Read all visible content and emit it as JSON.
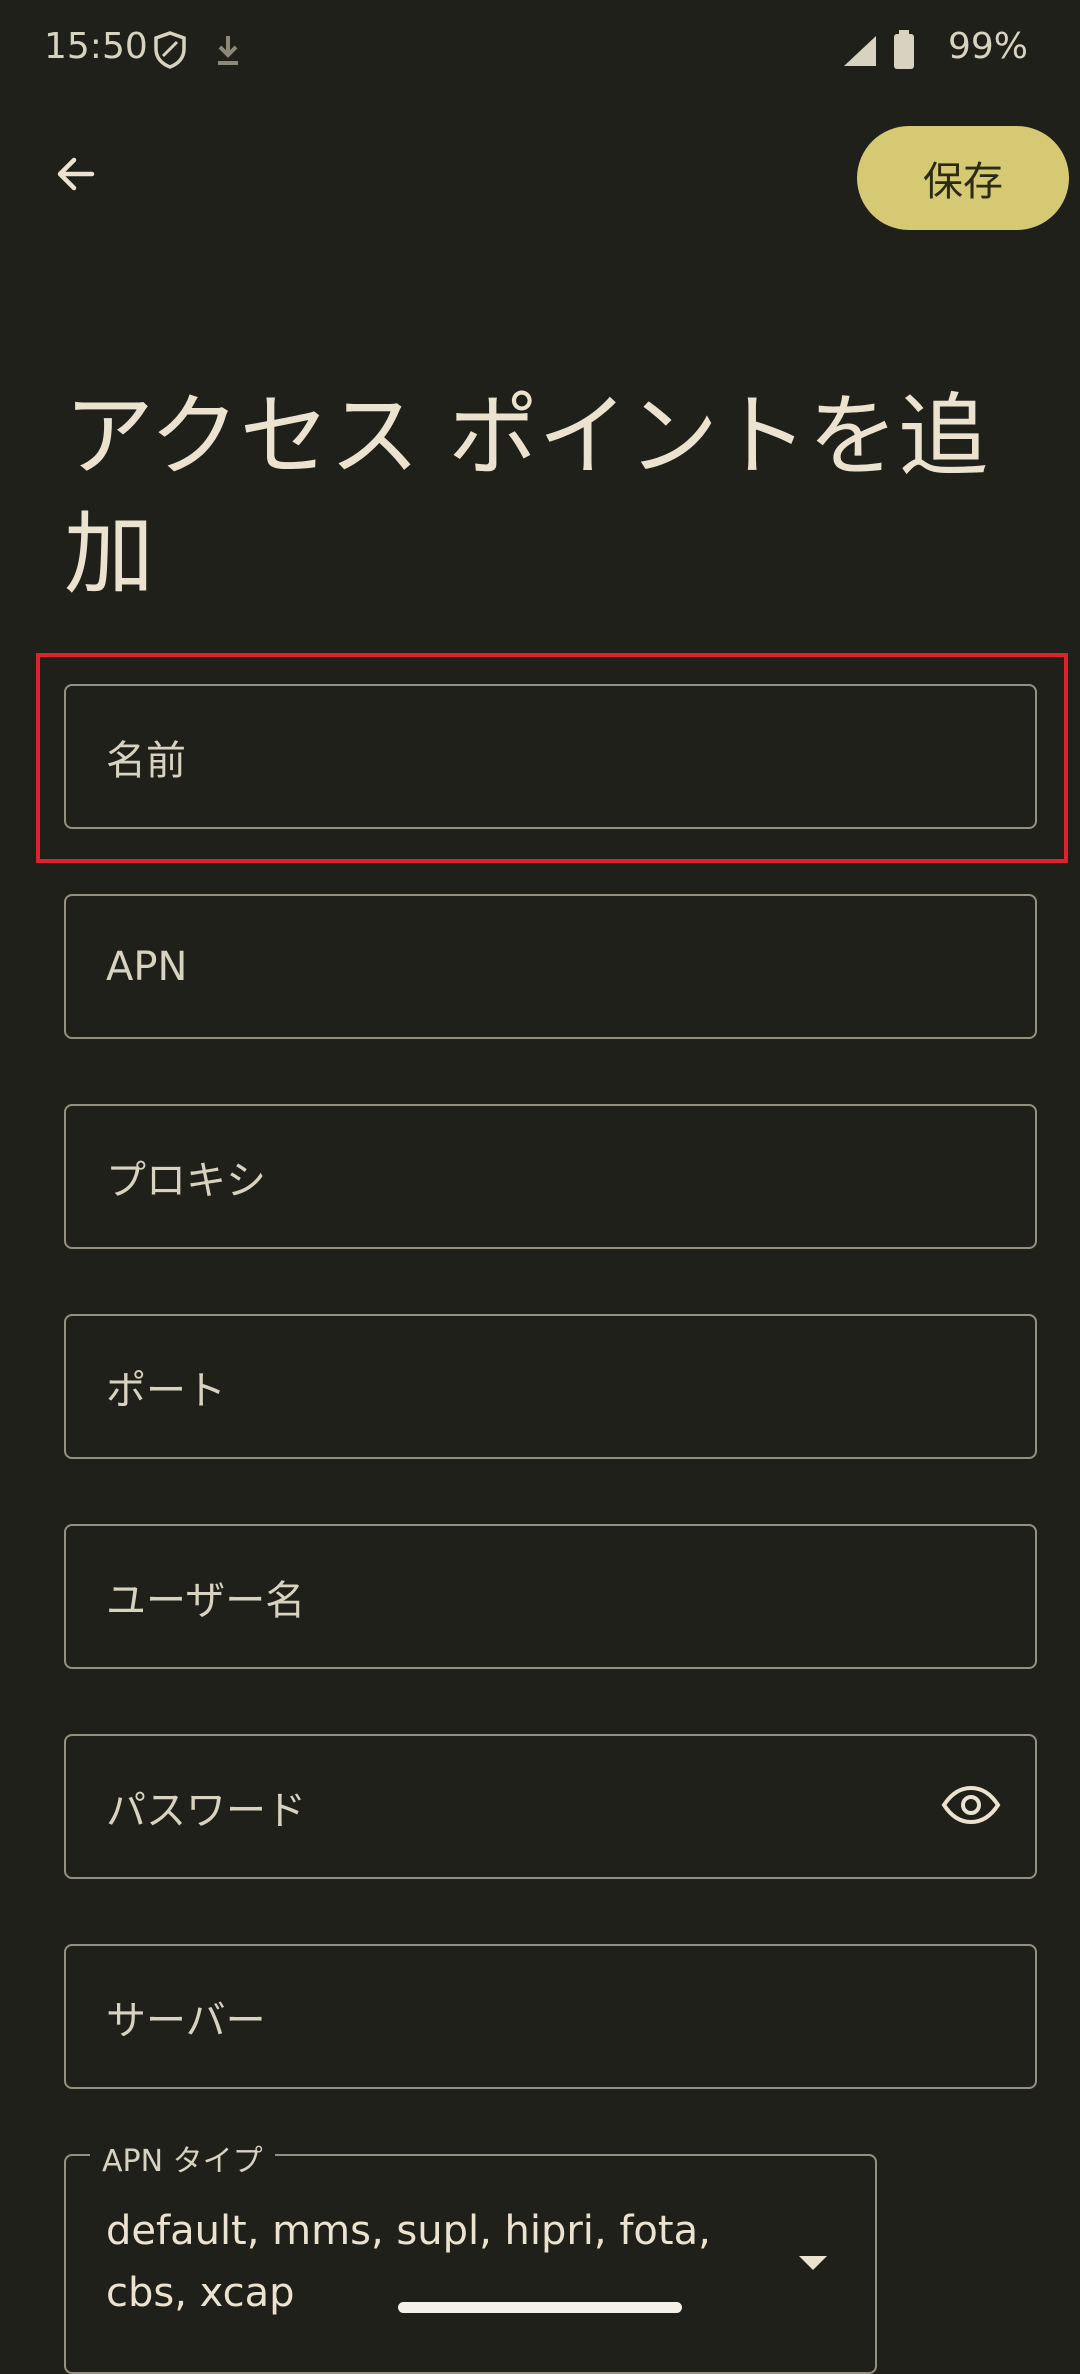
{
  "status_bar": {
    "time": "15:50",
    "battery_text": "99%",
    "icons": [
      "shield-icon",
      "download-icon",
      "signal-icon",
      "battery-icon"
    ]
  },
  "app_bar": {
    "back_icon": "arrow-left-icon",
    "save_label": "保存"
  },
  "page": {
    "title": "アクセス ポイントを追加"
  },
  "fields": [
    {
      "placeholder": "名前"
    },
    {
      "placeholder": "APN"
    },
    {
      "placeholder": "プロキシ"
    },
    {
      "placeholder": "ポート"
    },
    {
      "placeholder": "ユーザー名"
    },
    {
      "placeholder": "パスワード",
      "icon": "eye-icon"
    },
    {
      "placeholder": "サーバー"
    }
  ],
  "apn_type": {
    "label": "APN タイプ",
    "value": "default, mms, supl, hipri, fota, cbs, xcap"
  },
  "colors": {
    "background": "#20201a",
    "accent": "#d5c974",
    "text": "#ebe3cf",
    "outline": "#959180",
    "highlight": "#e0202a"
  }
}
